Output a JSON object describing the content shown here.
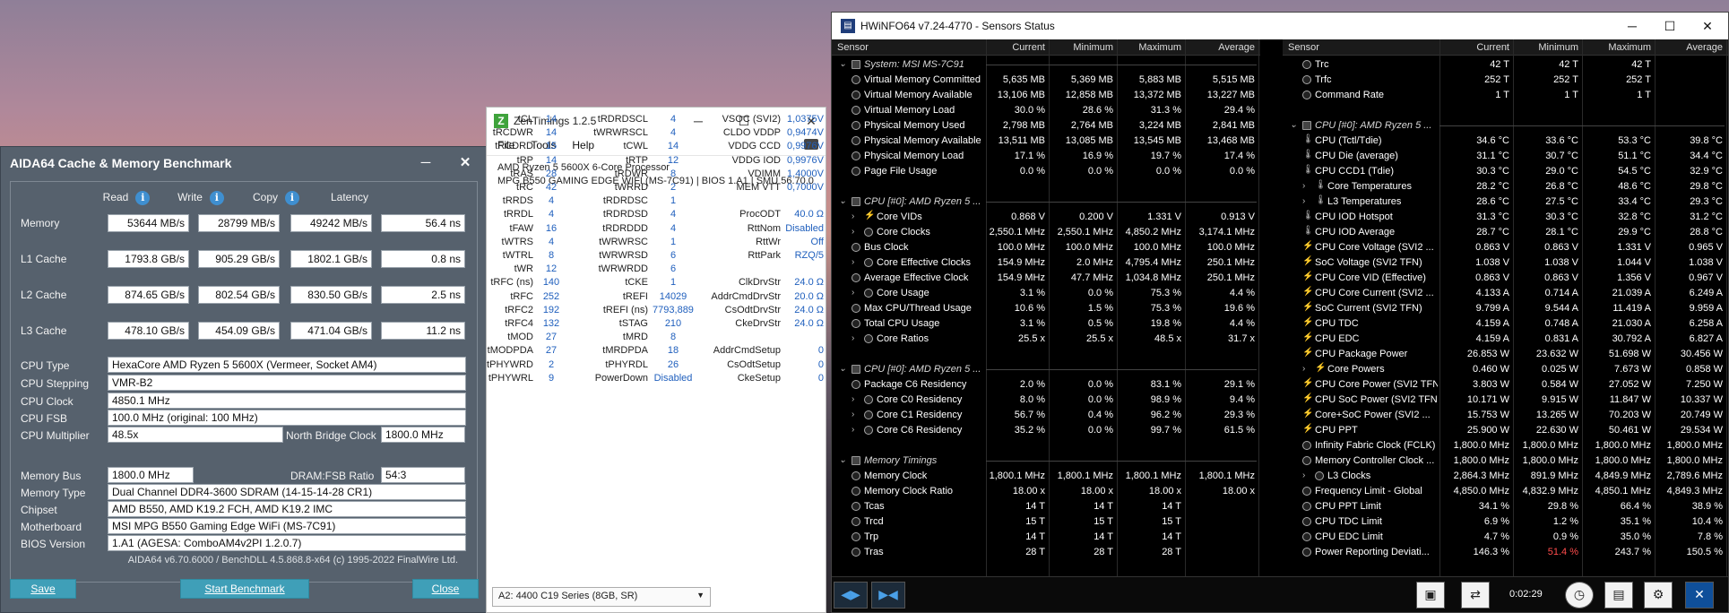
{
  "aida": {
    "title": "AIDA64 Cache & Memory Benchmark",
    "headers": {
      "read": "Read",
      "write": "Write",
      "copy": "Copy",
      "latency": "Latency"
    },
    "bench_rows": [
      {
        "label": "Memory",
        "read": "53644 MB/s",
        "write": "28799 MB/s",
        "copy": "49242 MB/s",
        "latency": "56.4 ns"
      },
      {
        "label": "L1 Cache",
        "read": "1793.8 GB/s",
        "write": "905.29 GB/s",
        "copy": "1802.1 GB/s",
        "latency": "0.8 ns"
      },
      {
        "label": "L2 Cache",
        "read": "874.65 GB/s",
        "write": "802.54 GB/s",
        "copy": "830.50 GB/s",
        "latency": "2.5 ns"
      },
      {
        "label": "L3 Cache",
        "read": "478.10 GB/s",
        "write": "454.09 GB/s",
        "copy": "471.04 GB/s",
        "latency": "11.2 ns"
      }
    ],
    "cpu_type_label": "CPU Type",
    "cpu_type": "HexaCore AMD Ryzen 5 5600X  (Vermeer, Socket AM4)",
    "cpu_stepping_label": "CPU Stepping",
    "cpu_stepping": "VMR-B2",
    "cpu_clock_label": "CPU Clock",
    "cpu_clock": "4850.1 MHz",
    "cpu_fsb_label": "CPU FSB",
    "cpu_fsb": "100.0 MHz  (original: 100 MHz)",
    "cpu_mult_label": "CPU Multiplier",
    "cpu_mult": "48.5x",
    "nb_clock_label": "North Bridge Clock",
    "nb_clock": "1800.0 MHz",
    "mem_bus_label": "Memory Bus",
    "mem_bus": "1800.0 MHz",
    "dram_ratio_label": "DRAM:FSB Ratio",
    "dram_ratio": "54:3",
    "mem_type_label": "Memory Type",
    "mem_type": "Dual Channel DDR4-3600 SDRAM  (14-15-14-28 CR1)",
    "chipset_label": "Chipset",
    "chipset": "AMD B550, AMD K19.2 FCH, AMD K19.2 IMC",
    "mobo_label": "Motherboard",
    "mobo": "MSI MPG B550 Gaming Edge WiFi (MS-7C91)",
    "bios_label": "BIOS Version",
    "bios": "1.A1  (AGESA: ComboAM4v2PI 1.2.0.7)",
    "footer": "AIDA64 v6.70.6000 / BenchDLL 4.5.868.8-x64  (c) 1995-2022 FinalWire Ltd.",
    "save": "Save",
    "start": "Start Benchmark",
    "close": "Close"
  },
  "zen": {
    "title": "ZenTimings 1.2.5",
    "menu": [
      "File",
      "Tools",
      "Help"
    ],
    "cpu": "AMD Ryzen 5 5600X 6-Core Processor",
    "board": "MPG B550 GAMING EDGE WIFI (MS-7C91) | BIOS 1.A1 | SMU 56.70.0",
    "top_rows": [
      [
        "Freq",
        "3600",
        "Capacity",
        "16GB",
        "MCLK",
        "1800.00"
      ],
      [
        "BGS",
        "Disabled",
        "BGS Alt",
        "Enabled",
        "FCLK",
        "1800.00"
      ],
      [
        "GDM",
        "Enabled",
        "Cmd2T",
        "1T",
        "UCLK",
        "1800.00"
      ]
    ],
    "rows": [
      [
        "tCL",
        "14",
        "tRDRDSCL",
        "4",
        "VSOC (SVI2)",
        "1,0375V"
      ],
      [
        "tRCDWR",
        "14",
        "tWRWRSCL",
        "4",
        "CLDO VDDP",
        "0,9474V"
      ],
      [
        "tRCDRD",
        "15",
        "tCWL",
        "14",
        "VDDG CCD",
        "0,9976V"
      ],
      [
        "tRP",
        "14",
        "tRTP",
        "12",
        "VDDG IOD",
        "0,9976V"
      ],
      [
        "tRAS",
        "28",
        "tRDWR",
        "8",
        "VDIMM",
        "1,4000V"
      ],
      [
        "tRC",
        "42",
        "tWRRD",
        "2",
        "MEM VTT",
        "0,7000V"
      ],
      [
        "tRRDS",
        "4",
        "tRDRDSC",
        "1",
        "",
        ""
      ],
      [
        "tRRDL",
        "4",
        "tRDRDSD",
        "4",
        "ProcODT",
        "40.0 Ω"
      ],
      [
        "tFAW",
        "16",
        "tRDRDDD",
        "4",
        "RttNom",
        "Disabled"
      ],
      [
        "tWTRS",
        "4",
        "tWRWRSC",
        "1",
        "RttWr",
        "Off"
      ],
      [
        "tWTRL",
        "8",
        "tWRWRSD",
        "6",
        "RttPark",
        "RZQ/5"
      ],
      [
        "tWR",
        "12",
        "tWRWRDD",
        "6",
        "",
        ""
      ],
      [
        "tRFC (ns)",
        "140",
        "tCKE",
        "1",
        "ClkDrvStr",
        "24.0 Ω"
      ],
      [
        "tRFC",
        "252",
        "tREFI",
        "14029",
        "AddrCmdDrvStr",
        "20.0 Ω"
      ],
      [
        "tRFC2",
        "192",
        "tREFI (ns)",
        "7793,889",
        "CsOdtDrvStr",
        "24.0 Ω"
      ],
      [
        "tRFC4",
        "132",
        "tSTAG",
        "210",
        "CkeDrvStr",
        "24.0 Ω"
      ],
      [
        "tMOD",
        "27",
        "tMRD",
        "8",
        "",
        ""
      ],
      [
        "tMODPDA",
        "27",
        "tMRDPDA",
        "18",
        "AddrCmdSetup",
        "0"
      ],
      [
        "tPHYWRD",
        "2",
        "tPHYRDL",
        "26",
        "CsOdtSetup",
        "0"
      ],
      [
        "tPHYWRL",
        "9",
        "PowerDown",
        "Disabled",
        "CkeSetup",
        "0"
      ]
    ],
    "profile": "A2: 4400 C19 Series (8GB, SR)"
  },
  "hw": {
    "title": "HWiNFO64 v7.24-4770 - Sensors Status",
    "headers": {
      "sensor": "Sensor",
      "current": "Current",
      "minimum": "Minimum",
      "maximum": "Maximum",
      "average": "Average"
    },
    "left": [
      {
        "t": "g",
        "n": "System: MSI MS-7C91"
      },
      {
        "t": "r",
        "i": "o",
        "n": "Virtual Memory Committed",
        "v": [
          "5,635 MB",
          "5,369 MB",
          "5,883 MB",
          "5,515 MB"
        ]
      },
      {
        "t": "r",
        "i": "o",
        "n": "Virtual Memory Available",
        "v": [
          "13,106 MB",
          "12,858 MB",
          "13,372 MB",
          "13,227 MB"
        ]
      },
      {
        "t": "r",
        "i": "o",
        "n": "Virtual Memory Load",
        "v": [
          "30.0 %",
          "28.6 %",
          "31.3 %",
          "29.4 %"
        ]
      },
      {
        "t": "r",
        "i": "o",
        "n": "Physical Memory Used",
        "v": [
          "2,798 MB",
          "2,764 MB",
          "3,224 MB",
          "2,841 MB"
        ]
      },
      {
        "t": "r",
        "i": "o",
        "n": "Physical Memory Available",
        "v": [
          "13,511 MB",
          "13,085 MB",
          "13,545 MB",
          "13,468 MB"
        ]
      },
      {
        "t": "r",
        "i": "o",
        "n": "Physical Memory Load",
        "v": [
          "17.1 %",
          "16.9 %",
          "19.7 %",
          "17.4 %"
        ]
      },
      {
        "t": "r",
        "i": "o",
        "n": "Page File Usage",
        "v": [
          "0.0 %",
          "0.0 %",
          "0.0 %",
          "0.0 %"
        ]
      },
      {
        "t": "s"
      },
      {
        "t": "g",
        "n": "CPU [#0]: AMD Ryzen 5 ..."
      },
      {
        "t": "r",
        "i": "b",
        "x": 1,
        "n": "Core VIDs",
        "v": [
          "0.868 V",
          "0.200 V",
          "1.331 V",
          "0.913 V"
        ]
      },
      {
        "t": "r",
        "i": "o",
        "x": 1,
        "n": "Core Clocks",
        "v": [
          "2,550.1 MHz",
          "2,550.1 MHz",
          "4,850.2 MHz",
          "3,174.1 MHz"
        ]
      },
      {
        "t": "r",
        "i": "o",
        "n": "Bus Clock",
        "v": [
          "100.0 MHz",
          "100.0 MHz",
          "100.0 MHz",
          "100.0 MHz"
        ]
      },
      {
        "t": "r",
        "i": "o",
        "x": 1,
        "n": "Core Effective Clocks",
        "v": [
          "154.9 MHz",
          "2.0 MHz",
          "4,795.4 MHz",
          "250.1 MHz"
        ]
      },
      {
        "t": "r",
        "i": "o",
        "n": "Average Effective Clock",
        "v": [
          "154.9 MHz",
          "47.7 MHz",
          "1,034.8 MHz",
          "250.1 MHz"
        ]
      },
      {
        "t": "r",
        "i": "o",
        "x": 1,
        "n": "Core Usage",
        "v": [
          "3.1 %",
          "0.0 %",
          "75.3 %",
          "4.4 %"
        ]
      },
      {
        "t": "r",
        "i": "o",
        "n": "Max CPU/Thread Usage",
        "v": [
          "10.6 %",
          "1.5 %",
          "75.3 %",
          "19.6 %"
        ]
      },
      {
        "t": "r",
        "i": "o",
        "n": "Total CPU Usage",
        "v": [
          "3.1 %",
          "0.5 %",
          "19.8 %",
          "4.4 %"
        ]
      },
      {
        "t": "r",
        "i": "o",
        "x": 1,
        "n": "Core Ratios",
        "v": [
          "25.5 x",
          "25.5 x",
          "48.5 x",
          "31.7 x"
        ]
      },
      {
        "t": "s"
      },
      {
        "t": "g",
        "n": "CPU [#0]: AMD Ryzen 5 ..."
      },
      {
        "t": "r",
        "i": "o",
        "n": "Package C6 Residency",
        "v": [
          "2.0 %",
          "0.0 %",
          "83.1 %",
          "29.1 %"
        ]
      },
      {
        "t": "r",
        "i": "o",
        "x": 1,
        "n": "Core C0 Residency",
        "v": [
          "8.0 %",
          "0.0 %",
          "98.9 %",
          "9.4 %"
        ]
      },
      {
        "t": "r",
        "i": "o",
        "x": 1,
        "n": "Core C1 Residency",
        "v": [
          "56.7 %",
          "0.4 %",
          "96.2 %",
          "29.3 %"
        ]
      },
      {
        "t": "r",
        "i": "o",
        "x": 1,
        "n": "Core C6 Residency",
        "v": [
          "35.2 %",
          "0.0 %",
          "99.7 %",
          "61.5 %"
        ]
      },
      {
        "t": "s"
      },
      {
        "t": "g",
        "n": "Memory Timings"
      },
      {
        "t": "r",
        "i": "o",
        "n": "Memory Clock",
        "v": [
          "1,800.1 MHz",
          "1,800.1 MHz",
          "1,800.1 MHz",
          "1,800.1 MHz"
        ]
      },
      {
        "t": "r",
        "i": "o",
        "n": "Memory Clock Ratio",
        "v": [
          "18.00 x",
          "18.00 x",
          "18.00 x",
          "18.00 x"
        ]
      },
      {
        "t": "r",
        "i": "o",
        "n": "Tcas",
        "v": [
          "14 T",
          "14 T",
          "14 T",
          ""
        ]
      },
      {
        "t": "r",
        "i": "o",
        "n": "Trcd",
        "v": [
          "15 T",
          "15 T",
          "15 T",
          ""
        ]
      },
      {
        "t": "r",
        "i": "o",
        "n": "Trp",
        "v": [
          "14 T",
          "14 T",
          "14 T",
          ""
        ]
      },
      {
        "t": "r",
        "i": "o",
        "n": "Tras",
        "v": [
          "28 T",
          "28 T",
          "28 T",
          ""
        ]
      }
    ],
    "right": [
      {
        "t": "r",
        "i": "o",
        "n": "Trc",
        "v": [
          "42 T",
          "42 T",
          "42 T",
          ""
        ]
      },
      {
        "t": "r",
        "i": "o",
        "n": "Trfc",
        "v": [
          "252 T",
          "252 T",
          "252 T",
          ""
        ]
      },
      {
        "t": "r",
        "i": "o",
        "n": "Command Rate",
        "v": [
          "1 T",
          "1 T",
          "1 T",
          ""
        ]
      },
      {
        "t": "s"
      },
      {
        "t": "g",
        "n": "CPU [#0]: AMD Ryzen 5 ..."
      },
      {
        "t": "r",
        "i": "t",
        "n": "CPU (Tctl/Tdie)",
        "v": [
          "34.6 °C",
          "33.6 °C",
          "53.3 °C",
          "39.8 °C"
        ]
      },
      {
        "t": "r",
        "i": "t",
        "n": "CPU Die (average)",
        "v": [
          "31.1 °C",
          "30.7 °C",
          "51.1 °C",
          "34.4 °C"
        ]
      },
      {
        "t": "r",
        "i": "t",
        "n": "CPU CCD1 (Tdie)",
        "v": [
          "30.3 °C",
          "29.0 °C",
          "54.5 °C",
          "32.9 °C"
        ]
      },
      {
        "t": "r",
        "i": "t",
        "x": 1,
        "n": "Core Temperatures",
        "v": [
          "28.2 °C",
          "26.8 °C",
          "48.6 °C",
          "29.8 °C"
        ]
      },
      {
        "t": "r",
        "i": "t",
        "x": 1,
        "n": "L3 Temperatures",
        "v": [
          "28.6 °C",
          "27.5 °C",
          "33.4 °C",
          "29.3 °C"
        ]
      },
      {
        "t": "r",
        "i": "t",
        "n": "CPU IOD Hotspot",
        "v": [
          "31.3 °C",
          "30.3 °C",
          "32.8 °C",
          "31.2 °C"
        ]
      },
      {
        "t": "r",
        "i": "t",
        "n": "CPU IOD Average",
        "v": [
          "28.7 °C",
          "28.1 °C",
          "29.9 °C",
          "28.8 °C"
        ]
      },
      {
        "t": "r",
        "i": "b",
        "n": "CPU Core Voltage (SVI2 ...",
        "v": [
          "0.863 V",
          "0.863 V",
          "1.331 V",
          "0.965 V"
        ]
      },
      {
        "t": "r",
        "i": "b",
        "n": "SoC Voltage (SVI2 TFN)",
        "v": [
          "1.038 V",
          "1.038 V",
          "1.044 V",
          "1.038 V"
        ]
      },
      {
        "t": "r",
        "i": "b",
        "n": "CPU Core VID (Effective)",
        "v": [
          "0.863 V",
          "0.863 V",
          "1.356 V",
          "0.967 V"
        ]
      },
      {
        "t": "r",
        "i": "b",
        "n": "CPU Core Current (SVI2 ...",
        "v": [
          "4.133 A",
          "0.714 A",
          "21.039 A",
          "6.249 A"
        ]
      },
      {
        "t": "r",
        "i": "b",
        "n": "SoC Current (SVI2 TFN)",
        "v": [
          "9.799 A",
          "9.544 A",
          "11.419 A",
          "9.959 A"
        ]
      },
      {
        "t": "r",
        "i": "b",
        "n": "CPU TDC",
        "v": [
          "4.159 A",
          "0.748 A",
          "21.030 A",
          "6.258 A"
        ]
      },
      {
        "t": "r",
        "i": "b",
        "n": "CPU EDC",
        "v": [
          "4.159 A",
          "0.831 A",
          "30.792 A",
          "6.827 A"
        ]
      },
      {
        "t": "r",
        "i": "b",
        "n": "CPU Package Power",
        "v": [
          "26.853 W",
          "23.632 W",
          "51.698 W",
          "30.456 W"
        ]
      },
      {
        "t": "r",
        "i": "b",
        "x": 1,
        "n": "Core Powers",
        "v": [
          "0.460 W",
          "0.025 W",
          "7.673 W",
          "0.858 W"
        ]
      },
      {
        "t": "r",
        "i": "b",
        "n": "CPU Core Power (SVI2 TFN)",
        "v": [
          "3.803 W",
          "0.584 W",
          "27.052 W",
          "7.250 W"
        ]
      },
      {
        "t": "r",
        "i": "b",
        "n": "CPU SoC Power (SVI2 TFN)",
        "v": [
          "10.171 W",
          "9.915 W",
          "11.847 W",
          "10.337 W"
        ]
      },
      {
        "t": "r",
        "i": "b",
        "n": "Core+SoC Power (SVI2 ...",
        "v": [
          "15.753 W",
          "13.265 W",
          "70.203 W",
          "20.749 W"
        ]
      },
      {
        "t": "r",
        "i": "b",
        "n": "CPU PPT",
        "v": [
          "25.900 W",
          "22.630 W",
          "50.461 W",
          "29.534 W"
        ]
      },
      {
        "t": "r",
        "i": "o",
        "n": "Infinity Fabric Clock (FCLK)",
        "v": [
          "1,800.0 MHz",
          "1,800.0 MHz",
          "1,800.0 MHz",
          "1,800.0 MHz"
        ]
      },
      {
        "t": "r",
        "i": "o",
        "n": "Memory Controller Clock ...",
        "v": [
          "1,800.0 MHz",
          "1,800.0 MHz",
          "1,800.0 MHz",
          "1,800.0 MHz"
        ]
      },
      {
        "t": "r",
        "i": "o",
        "x": 1,
        "n": "L3 Clocks",
        "v": [
          "2,864.3 MHz",
          "891.9 MHz",
          "4,849.9 MHz",
          "2,789.6 MHz"
        ]
      },
      {
        "t": "r",
        "i": "o",
        "n": "Frequency Limit - Global",
        "v": [
          "4,850.0 MHz",
          "4,832.9 MHz",
          "4,850.1 MHz",
          "4,849.3 MHz"
        ]
      },
      {
        "t": "r",
        "i": "o",
        "n": "CPU PPT Limit",
        "v": [
          "34.1 %",
          "29.8 %",
          "66.4 %",
          "38.9 %"
        ]
      },
      {
        "t": "r",
        "i": "o",
        "n": "CPU TDC Limit",
        "v": [
          "6.9 %",
          "1.2 %",
          "35.1 %",
          "10.4 %"
        ]
      },
      {
        "t": "r",
        "i": "o",
        "n": "CPU EDC Limit",
        "v": [
          "4.7 %",
          "0.9 %",
          "35.0 %",
          "7.8 %"
        ]
      },
      {
        "t": "r",
        "i": "o",
        "n": "Power Reporting Deviati...",
        "v": [
          "146.3 %",
          "51.4 %",
          "243.7 %",
          "150.5 %"
        ],
        "red": 1
      }
    ],
    "elapsed": "0:02:29",
    "icons": [
      "expand-left-icon",
      "collapse-right-icon",
      "network-icon",
      "network-config-icon",
      "clock-icon",
      "report-icon",
      "settings-icon",
      "exit-icon"
    ]
  }
}
